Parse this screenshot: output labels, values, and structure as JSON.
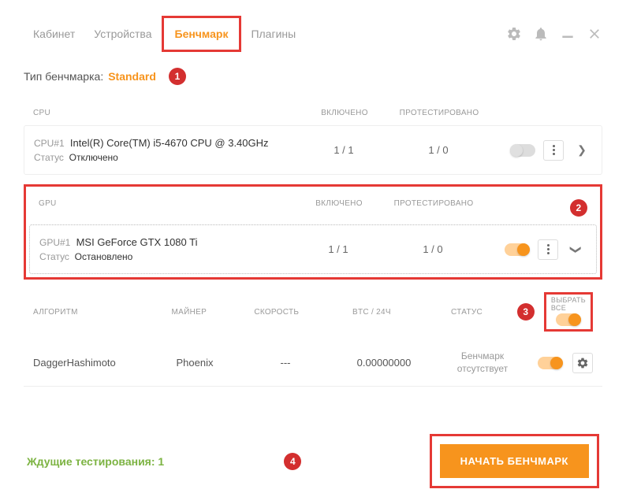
{
  "tabs": {
    "cabinet": "Кабинет",
    "devices": "Устройства",
    "benchmark": "Бенчмарк",
    "plugins": "Плагины"
  },
  "benchType": {
    "label": "Тип бенчмарка:",
    "value": "Standard"
  },
  "headers": {
    "enabled": "ВКЛЮЧЕНО",
    "tested": "ПРОТЕСТИРОВАНО",
    "cpu": "CPU",
    "gpu": "GPU"
  },
  "cpu": {
    "label": "CPU#1",
    "name": "Intel(R) Core(TM) i5-4670 CPU @ 3.40GHz",
    "statusLabel": "Статус",
    "status": "Отключено",
    "enabled": "1 / 1",
    "tested": "1 / 0"
  },
  "gpu": {
    "label": "GPU#1",
    "name": "MSI GeForce GTX 1080 Ti",
    "statusLabel": "Статус",
    "status": "Остановлено",
    "enabled": "1 / 1",
    "tested": "1 / 0"
  },
  "algoHeaders": {
    "algo": "АЛГОРИТМ",
    "miner": "МАЙНЕР",
    "speed": "СКОРОСТЬ",
    "btc": "BTC / 24ч",
    "status": "СТАТУС",
    "selectAll": "ВЫБРАТЬ ВСЕ"
  },
  "algo": {
    "name": "DaggerHashimoto",
    "miner": "Phoenix",
    "speed": "---",
    "btc": "0.00000000",
    "status": "Бенчмарк отсутствует"
  },
  "footer": {
    "pending": "Ждущие тестирования: 1",
    "start": "НАЧАТЬ БЕНЧМАРК"
  },
  "badges": {
    "b1": "1",
    "b2": "2",
    "b3": "3",
    "b4": "4"
  }
}
